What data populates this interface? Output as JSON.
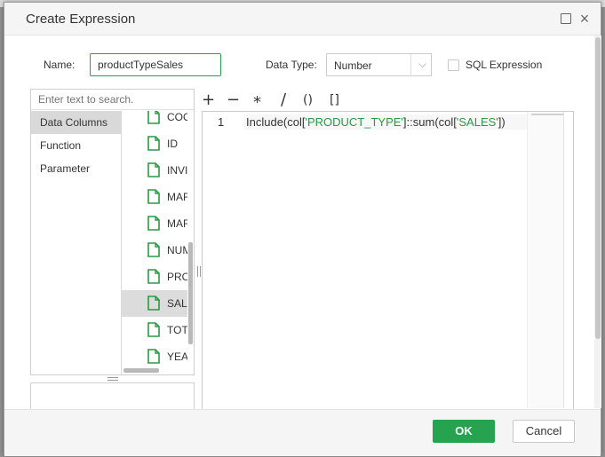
{
  "dialog": {
    "title": "Create Expression"
  },
  "form": {
    "name_label": "Name:",
    "name_value": "productTypeSales",
    "data_type_label": "Data Type:",
    "data_type_value": "Number",
    "sql_label": "SQL Expression",
    "sql_checked": false
  },
  "search": {
    "placeholder": "Enter text to search."
  },
  "categories": [
    {
      "label": "Data Columns",
      "active": true
    },
    {
      "label": "Function",
      "active": false
    },
    {
      "label": "Parameter",
      "active": false
    }
  ],
  "columns": [
    {
      "label": "COO",
      "active": false
    },
    {
      "label": "ID",
      "active": false
    },
    {
      "label": "INVI",
      "active": false
    },
    {
      "label": "MAF",
      "active": false
    },
    {
      "label": "MAF",
      "active": false
    },
    {
      "label": "NUM",
      "active": false
    },
    {
      "label": "PRO",
      "active": false
    },
    {
      "label": "SAL",
      "active": true
    },
    {
      "label": "TOT",
      "active": false
    },
    {
      "label": "YEA",
      "active": false
    }
  ],
  "operators": {
    "plus": "+",
    "minus": "−",
    "multiply": "*",
    "divide": "/",
    "parens": "()",
    "brackets": "[]"
  },
  "editor": {
    "line_number": "1",
    "code": {
      "p1": "Include(col[",
      "s1": "'PRODUCT_TYPE'",
      "p2": "]::sum(col[",
      "s2": "'SALES'",
      "p3": "])"
    }
  },
  "footer": {
    "ok_label": "OK",
    "cancel_label": "Cancel"
  },
  "colors": {
    "accent": "#26a34e",
    "string": "#2a9a45",
    "selected": "#d9d9d9"
  },
  "icons": {
    "window_max": "maximize-icon",
    "window_close": "close-icon",
    "column": "document-icon",
    "dropdown": "chevron-down-icon"
  }
}
